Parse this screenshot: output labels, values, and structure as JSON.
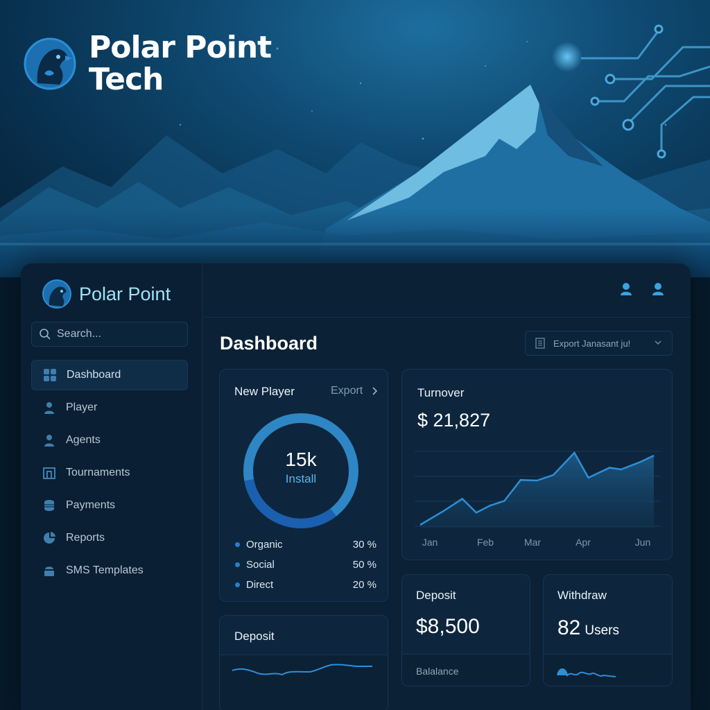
{
  "hero": {
    "brand_line1": "Polar Point",
    "brand_line2": "Tech"
  },
  "sidebar": {
    "brand": "Polar Point",
    "search_placeholder": "Search...",
    "items": [
      {
        "label": "Dashboard",
        "icon": "grid-icon",
        "active": true
      },
      {
        "label": "Player",
        "icon": "user-icon"
      },
      {
        "label": "Agents",
        "icon": "users-icon"
      },
      {
        "label": "Tournaments",
        "icon": "trophy-icon"
      },
      {
        "label": "Payments",
        "icon": "coin-stack-icon"
      },
      {
        "label": "Reports",
        "icon": "pie-chart-icon"
      },
      {
        "label": "SMS Templates",
        "icon": "message-icon"
      }
    ]
  },
  "header": {
    "title": "Dashboard",
    "export_label": "Export Janasant ju!"
  },
  "new_player": {
    "title": "New Player",
    "export_label": "Export",
    "center_value": "15k",
    "center_label": "Install",
    "legend": [
      {
        "label": "Organic",
        "pct": "30 %"
      },
      {
        "label": "Social",
        "pct": "50 %"
      },
      {
        "label": "Direct",
        "pct": "20 %"
      }
    ]
  },
  "turnover": {
    "title": "Turnover",
    "value": "$ 21,827"
  },
  "deposit": {
    "title": "Deposit",
    "value": "$8,500",
    "sub": "Balalance"
  },
  "withdraw": {
    "title": "Withdraw",
    "value": "82",
    "unit": "Users"
  },
  "deposit_small": {
    "title": "Deposit"
  },
  "colors": {
    "accent": "#2b8fd4",
    "donut_light": "#2f86c4",
    "donut_dark": "#1a5fb0",
    "line": "#2e8fd6"
  },
  "chart_data": {
    "type": "area",
    "categories": [
      "Jan",
      "Feb",
      "Mar",
      "Apr",
      "Jun"
    ],
    "x": [
      0,
      0.1,
      0.18,
      0.24,
      0.3,
      0.36,
      0.43,
      0.5,
      0.57,
      0.66,
      0.72,
      0.81,
      0.86,
      0.94,
      1.0
    ],
    "values": [
      5,
      30,
      52,
      27,
      40,
      48,
      86,
      85,
      95,
      135,
      90,
      108,
      105,
      118,
      130
    ],
    "ylim": [
      0,
      150
    ],
    "grid": true,
    "title": "",
    "xlabel": "",
    "ylabel": ""
  }
}
